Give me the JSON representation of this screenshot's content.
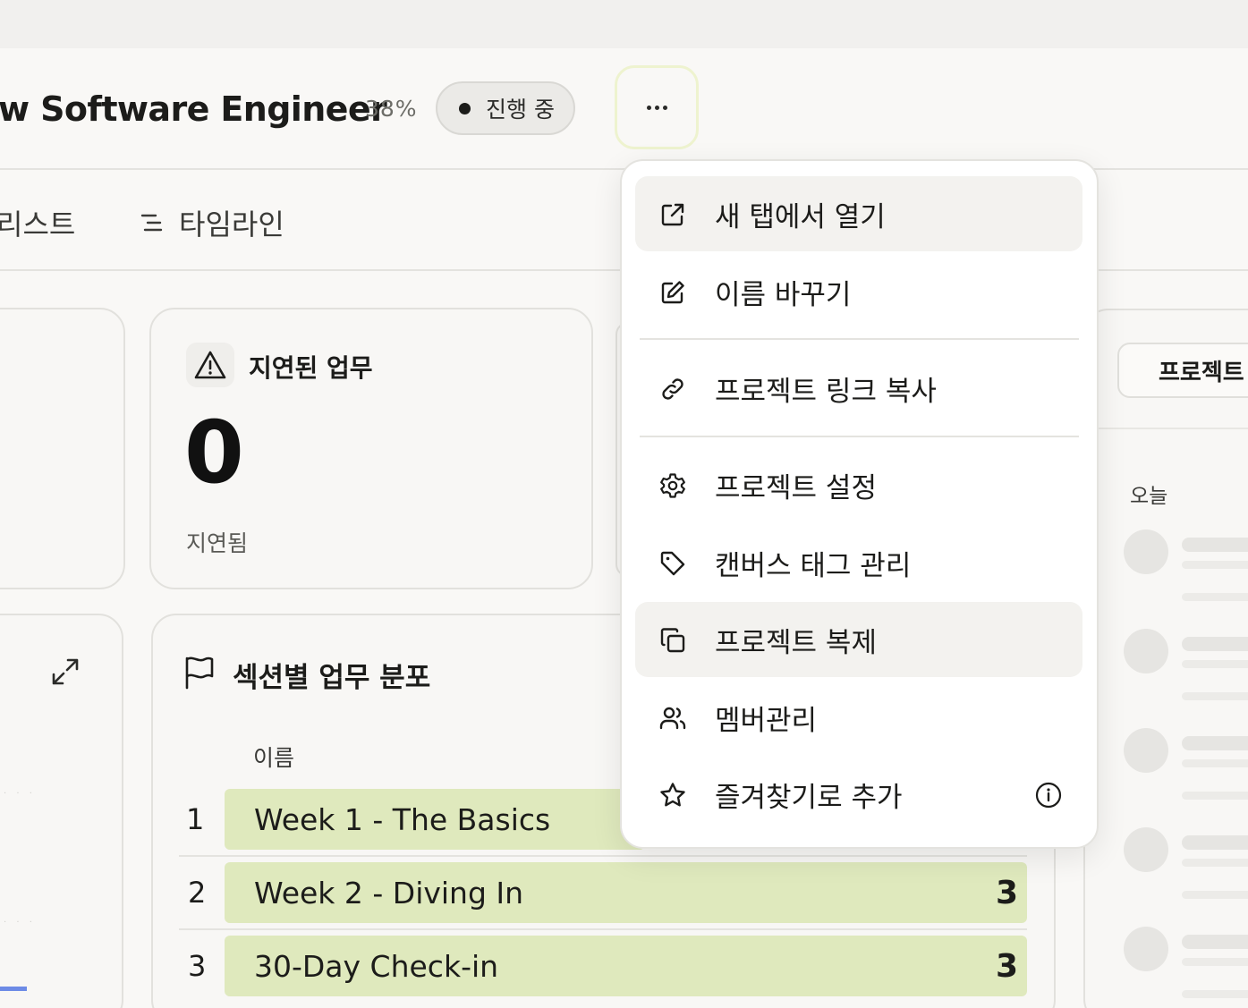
{
  "header": {
    "title": "w Software Engineer",
    "progress": "38%",
    "status": "진행 중",
    "more_icon": "more-horizontal-icon"
  },
  "tabs": [
    {
      "label": "리스트"
    },
    {
      "label": "타임라인",
      "icon": "timeline-icon"
    }
  ],
  "delay_card": {
    "title": "지연된 업무",
    "value": "0",
    "sublabel": "지연됨",
    "icon": "warning-triangle-icon"
  },
  "distribution": {
    "title": "섹션별 업무 분포",
    "column_name": "이름",
    "rows": [
      {
        "index": "1",
        "name": "Week 1 - The Basics",
        "count": ""
      },
      {
        "index": "2",
        "name": "Week 2 - Diving In",
        "count": "3"
      },
      {
        "index": "3",
        "name": "30-Day Check-in",
        "count": "3"
      }
    ]
  },
  "right_panel": {
    "tab_label": "프로젝트",
    "today_label": "오늘"
  },
  "menu": {
    "items": [
      {
        "label": "새 탭에서 열기",
        "icon": "external-link-icon"
      },
      {
        "label": "이름 바꾸기",
        "icon": "edit-icon"
      },
      {
        "label": "프로젝트 링크 복사",
        "icon": "link-icon"
      },
      {
        "label": "프로젝트 설정",
        "icon": "gear-icon"
      },
      {
        "label": "캔버스 태그 관리",
        "icon": "tag-icon"
      },
      {
        "label": "프로젝트 복제",
        "icon": "copy-icon"
      },
      {
        "label": "멤버관리",
        "icon": "users-icon"
      },
      {
        "label": "즐겨찾기로 추가",
        "icon": "star-icon",
        "trailing_icon": "info-icon"
      }
    ]
  },
  "colors": {
    "bar_green": "#dfe9bd",
    "menu_highlight": "#f3f2ef",
    "focus_ring": "#eef3cf"
  }
}
